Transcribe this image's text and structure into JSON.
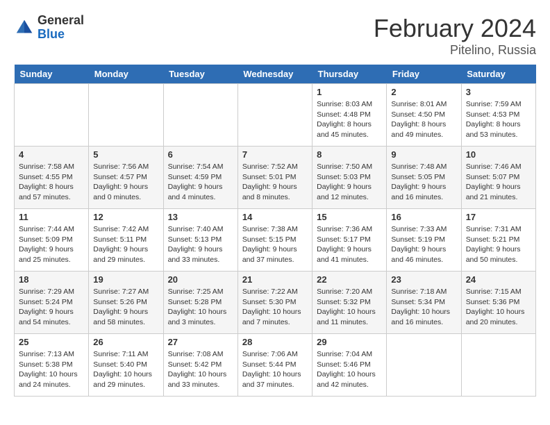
{
  "header": {
    "logo_general": "General",
    "logo_blue": "Blue",
    "month": "February 2024",
    "location": "Pitelino, Russia"
  },
  "weekdays": [
    "Sunday",
    "Monday",
    "Tuesday",
    "Wednesday",
    "Thursday",
    "Friday",
    "Saturday"
  ],
  "weeks": [
    [
      {
        "day": "",
        "info": ""
      },
      {
        "day": "",
        "info": ""
      },
      {
        "day": "",
        "info": ""
      },
      {
        "day": "",
        "info": ""
      },
      {
        "day": "1",
        "info": "Sunrise: 8:03 AM\nSunset: 4:48 PM\nDaylight: 8 hours\nand 45 minutes."
      },
      {
        "day": "2",
        "info": "Sunrise: 8:01 AM\nSunset: 4:50 PM\nDaylight: 8 hours\nand 49 minutes."
      },
      {
        "day": "3",
        "info": "Sunrise: 7:59 AM\nSunset: 4:53 PM\nDaylight: 8 hours\nand 53 minutes."
      }
    ],
    [
      {
        "day": "4",
        "info": "Sunrise: 7:58 AM\nSunset: 4:55 PM\nDaylight: 8 hours\nand 57 minutes."
      },
      {
        "day": "5",
        "info": "Sunrise: 7:56 AM\nSunset: 4:57 PM\nDaylight: 9 hours\nand 0 minutes."
      },
      {
        "day": "6",
        "info": "Sunrise: 7:54 AM\nSunset: 4:59 PM\nDaylight: 9 hours\nand 4 minutes."
      },
      {
        "day": "7",
        "info": "Sunrise: 7:52 AM\nSunset: 5:01 PM\nDaylight: 9 hours\nand 8 minutes."
      },
      {
        "day": "8",
        "info": "Sunrise: 7:50 AM\nSunset: 5:03 PM\nDaylight: 9 hours\nand 12 minutes."
      },
      {
        "day": "9",
        "info": "Sunrise: 7:48 AM\nSunset: 5:05 PM\nDaylight: 9 hours\nand 16 minutes."
      },
      {
        "day": "10",
        "info": "Sunrise: 7:46 AM\nSunset: 5:07 PM\nDaylight: 9 hours\nand 21 minutes."
      }
    ],
    [
      {
        "day": "11",
        "info": "Sunrise: 7:44 AM\nSunset: 5:09 PM\nDaylight: 9 hours\nand 25 minutes."
      },
      {
        "day": "12",
        "info": "Sunrise: 7:42 AM\nSunset: 5:11 PM\nDaylight: 9 hours\nand 29 minutes."
      },
      {
        "day": "13",
        "info": "Sunrise: 7:40 AM\nSunset: 5:13 PM\nDaylight: 9 hours\nand 33 minutes."
      },
      {
        "day": "14",
        "info": "Sunrise: 7:38 AM\nSunset: 5:15 PM\nDaylight: 9 hours\nand 37 minutes."
      },
      {
        "day": "15",
        "info": "Sunrise: 7:36 AM\nSunset: 5:17 PM\nDaylight: 9 hours\nand 41 minutes."
      },
      {
        "day": "16",
        "info": "Sunrise: 7:33 AM\nSunset: 5:19 PM\nDaylight: 9 hours\nand 46 minutes."
      },
      {
        "day": "17",
        "info": "Sunrise: 7:31 AM\nSunset: 5:21 PM\nDaylight: 9 hours\nand 50 minutes."
      }
    ],
    [
      {
        "day": "18",
        "info": "Sunrise: 7:29 AM\nSunset: 5:24 PM\nDaylight: 9 hours\nand 54 minutes."
      },
      {
        "day": "19",
        "info": "Sunrise: 7:27 AM\nSunset: 5:26 PM\nDaylight: 9 hours\nand 58 minutes."
      },
      {
        "day": "20",
        "info": "Sunrise: 7:25 AM\nSunset: 5:28 PM\nDaylight: 10 hours\nand 3 minutes."
      },
      {
        "day": "21",
        "info": "Sunrise: 7:22 AM\nSunset: 5:30 PM\nDaylight: 10 hours\nand 7 minutes."
      },
      {
        "day": "22",
        "info": "Sunrise: 7:20 AM\nSunset: 5:32 PM\nDaylight: 10 hours\nand 11 minutes."
      },
      {
        "day": "23",
        "info": "Sunrise: 7:18 AM\nSunset: 5:34 PM\nDaylight: 10 hours\nand 16 minutes."
      },
      {
        "day": "24",
        "info": "Sunrise: 7:15 AM\nSunset: 5:36 PM\nDaylight: 10 hours\nand 20 minutes."
      }
    ],
    [
      {
        "day": "25",
        "info": "Sunrise: 7:13 AM\nSunset: 5:38 PM\nDaylight: 10 hours\nand 24 minutes."
      },
      {
        "day": "26",
        "info": "Sunrise: 7:11 AM\nSunset: 5:40 PM\nDaylight: 10 hours\nand 29 minutes."
      },
      {
        "day": "27",
        "info": "Sunrise: 7:08 AM\nSunset: 5:42 PM\nDaylight: 10 hours\nand 33 minutes."
      },
      {
        "day": "28",
        "info": "Sunrise: 7:06 AM\nSunset: 5:44 PM\nDaylight: 10 hours\nand 37 minutes."
      },
      {
        "day": "29",
        "info": "Sunrise: 7:04 AM\nSunset: 5:46 PM\nDaylight: 10 hours\nand 42 minutes."
      },
      {
        "day": "",
        "info": ""
      },
      {
        "day": "",
        "info": ""
      }
    ]
  ]
}
